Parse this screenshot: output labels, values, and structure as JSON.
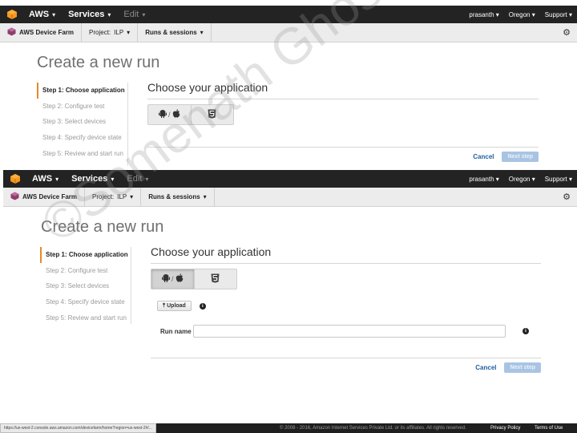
{
  "topnav": {
    "aws_label": "AWS",
    "services_label": "Services",
    "edit_label": "Edit",
    "user": "prasanth",
    "region": "Oregon",
    "support": "Support",
    "caret": "▾"
  },
  "subnav": {
    "app_name": "AWS Device Farm",
    "project_prefix": "Project:",
    "project_name": "ILP",
    "runs_label": "Runs & sessions"
  },
  "page": {
    "title": "Create a new run"
  },
  "steps": [
    "Step 1: Choose application",
    "Step 2: Configure test",
    "Step 3: Select devices",
    "Step 4: Specify device state",
    "Step 5: Review and start run"
  ],
  "content": {
    "section_title": "Choose your application",
    "platform_sep": "/",
    "upload_label": "Upload",
    "run_name_label": "Run name",
    "run_name_value": "",
    "cancel_label": "Cancel",
    "next_label": "Next step"
  },
  "footer": {
    "status_url": "https://us-west-2.console.aws.amazon.com/devicefarm/home?region=us-west-2#/...",
    "copyright": "© 2008 - 2016, Amazon Internet Services Private Ltd. or its affiliates. All rights reserved.",
    "privacy": "Privacy Policy",
    "terms": "Terms of Use"
  },
  "watermark": "©Somenath Ghosh",
  "colors": {
    "accent_orange": "#e8892b",
    "topnav_bg": "#232323",
    "link_blue": "#1e5f9e",
    "next_button_disabled": "#a9c4e3"
  },
  "icons": [
    "aws-cube-icon",
    "device-farm-icon",
    "gear-icon",
    "android-icon",
    "apple-icon",
    "html5-icon",
    "upload-icon",
    "info-icon"
  ]
}
